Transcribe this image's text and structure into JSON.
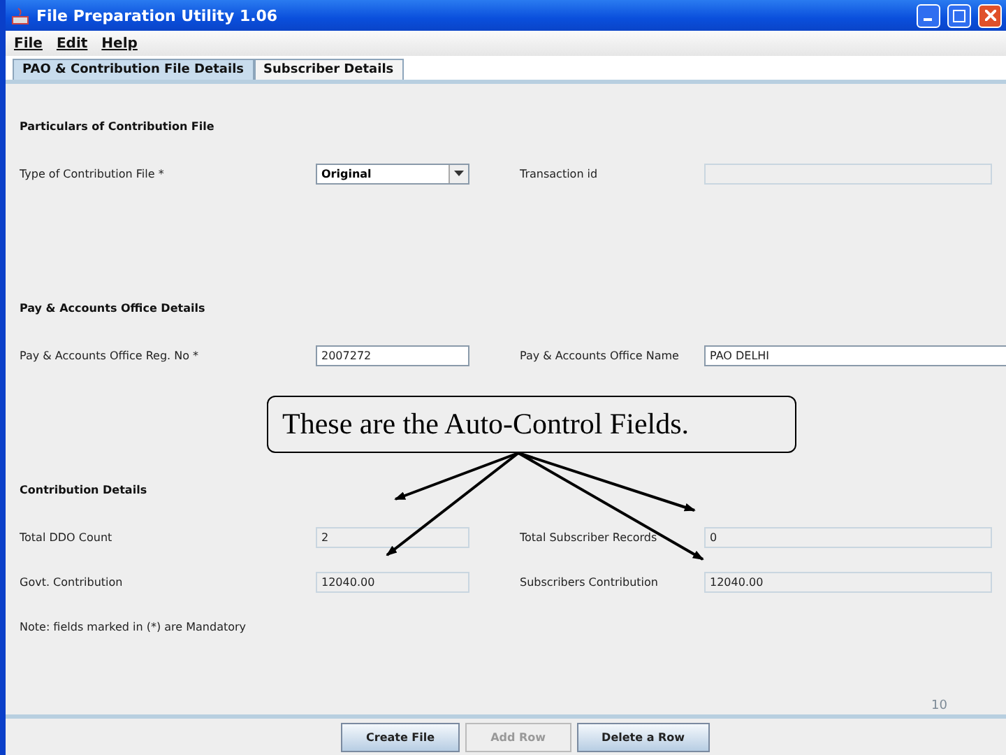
{
  "window": {
    "title": "File Preparation Utility 1.06"
  },
  "menu": [
    {
      "label": "File"
    },
    {
      "label": "Edit"
    },
    {
      "label": "Help"
    }
  ],
  "tabs": [
    {
      "label": "PAO & Contribution File Details",
      "selected": true
    },
    {
      "label": "Subscriber Details",
      "selected": false
    }
  ],
  "sections": [
    {
      "heading": "Particulars of Contribution File",
      "rows": [
        [
          {
            "label": "Type of Contribution File *",
            "kind": "combo",
            "value": "Original",
            "disabled": false
          },
          {
            "label": "Transaction id",
            "kind": "text",
            "disabled": true
          }
        ]
      ]
    },
    {
      "heading": "Pay & Accounts Office Details",
      "rows": [
        [
          {
            "label": "Pay & Accounts Office Reg. No *",
            "kind": "text",
            "value": "2007272",
            "disabled": false
          },
          {
            "label": "Pay & Accounts Office Name",
            "kind": "wide",
            "value": "PAO DELHI",
            "disabled": false
          }
        ]
      ]
    },
    {
      "heading": "Contribution Details",
      "rows": [
        [
          {
            "label": "Total DDO Count",
            "kind": "text",
            "value": "2",
            "disabled": true
          },
          {
            "label": "Total Subscriber Records",
            "kind": "text",
            "value": "0",
            "disabled": true
          }
        ],
        [
          {
            "label": "Govt. Contribution",
            "kind": "text",
            "value": "12040.00",
            "disabled": true
          },
          {
            "label": "Subscribers Contribution",
            "kind": "text",
            "value": "12040.00",
            "disabled": true
          }
        ]
      ]
    }
  ],
  "note": "Note: fields marked in (*) are Mandatory",
  "callout": {
    "text": "These are the Auto-Control Fields."
  },
  "buttons": [
    {
      "label": "Create File",
      "disabled": false
    },
    {
      "label": "Add Row",
      "disabled": true
    },
    {
      "label": "Delete a Row",
      "disabled": false
    }
  ],
  "page_number": "10"
}
